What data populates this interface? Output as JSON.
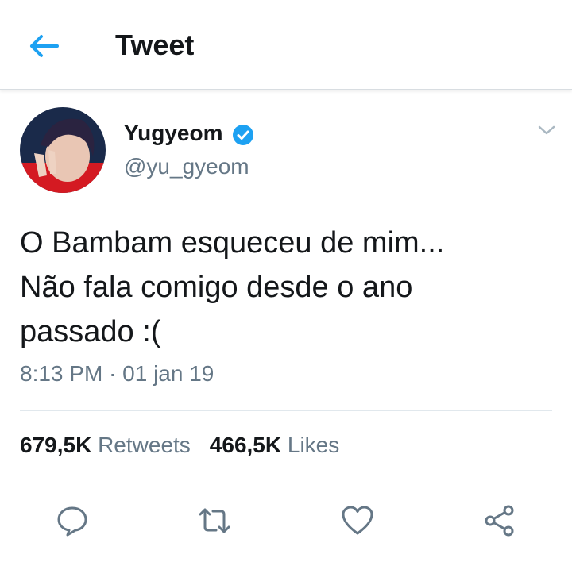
{
  "header": {
    "title": "Tweet",
    "back_icon": "back-arrow-icon"
  },
  "tweet": {
    "author": {
      "display_name": "Yugyeom",
      "handle": "@yu_gyeom",
      "verified": true,
      "verified_color": "#1da1f2"
    },
    "text_lines": [
      "O Bambam esqueceu de mim...",
      "Não fala comigo desde o ano",
      "passado :("
    ],
    "timestamp": "8:13 PM · 01 jan 19",
    "stats": {
      "retweets_count": "679,5K",
      "retweets_label": "Retweets",
      "likes_count": "466,5K",
      "likes_label": "Likes"
    }
  },
  "actions": [
    {
      "name": "reply",
      "icon": "reply-icon"
    },
    {
      "name": "retweet",
      "icon": "retweet-icon"
    },
    {
      "name": "like",
      "icon": "heart-icon"
    },
    {
      "name": "share",
      "icon": "share-icon"
    }
  ],
  "colors": {
    "accent": "#1da1f2",
    "secondary_text": "#657786",
    "primary_text": "#14171a",
    "divider": "#e1e8ed"
  }
}
